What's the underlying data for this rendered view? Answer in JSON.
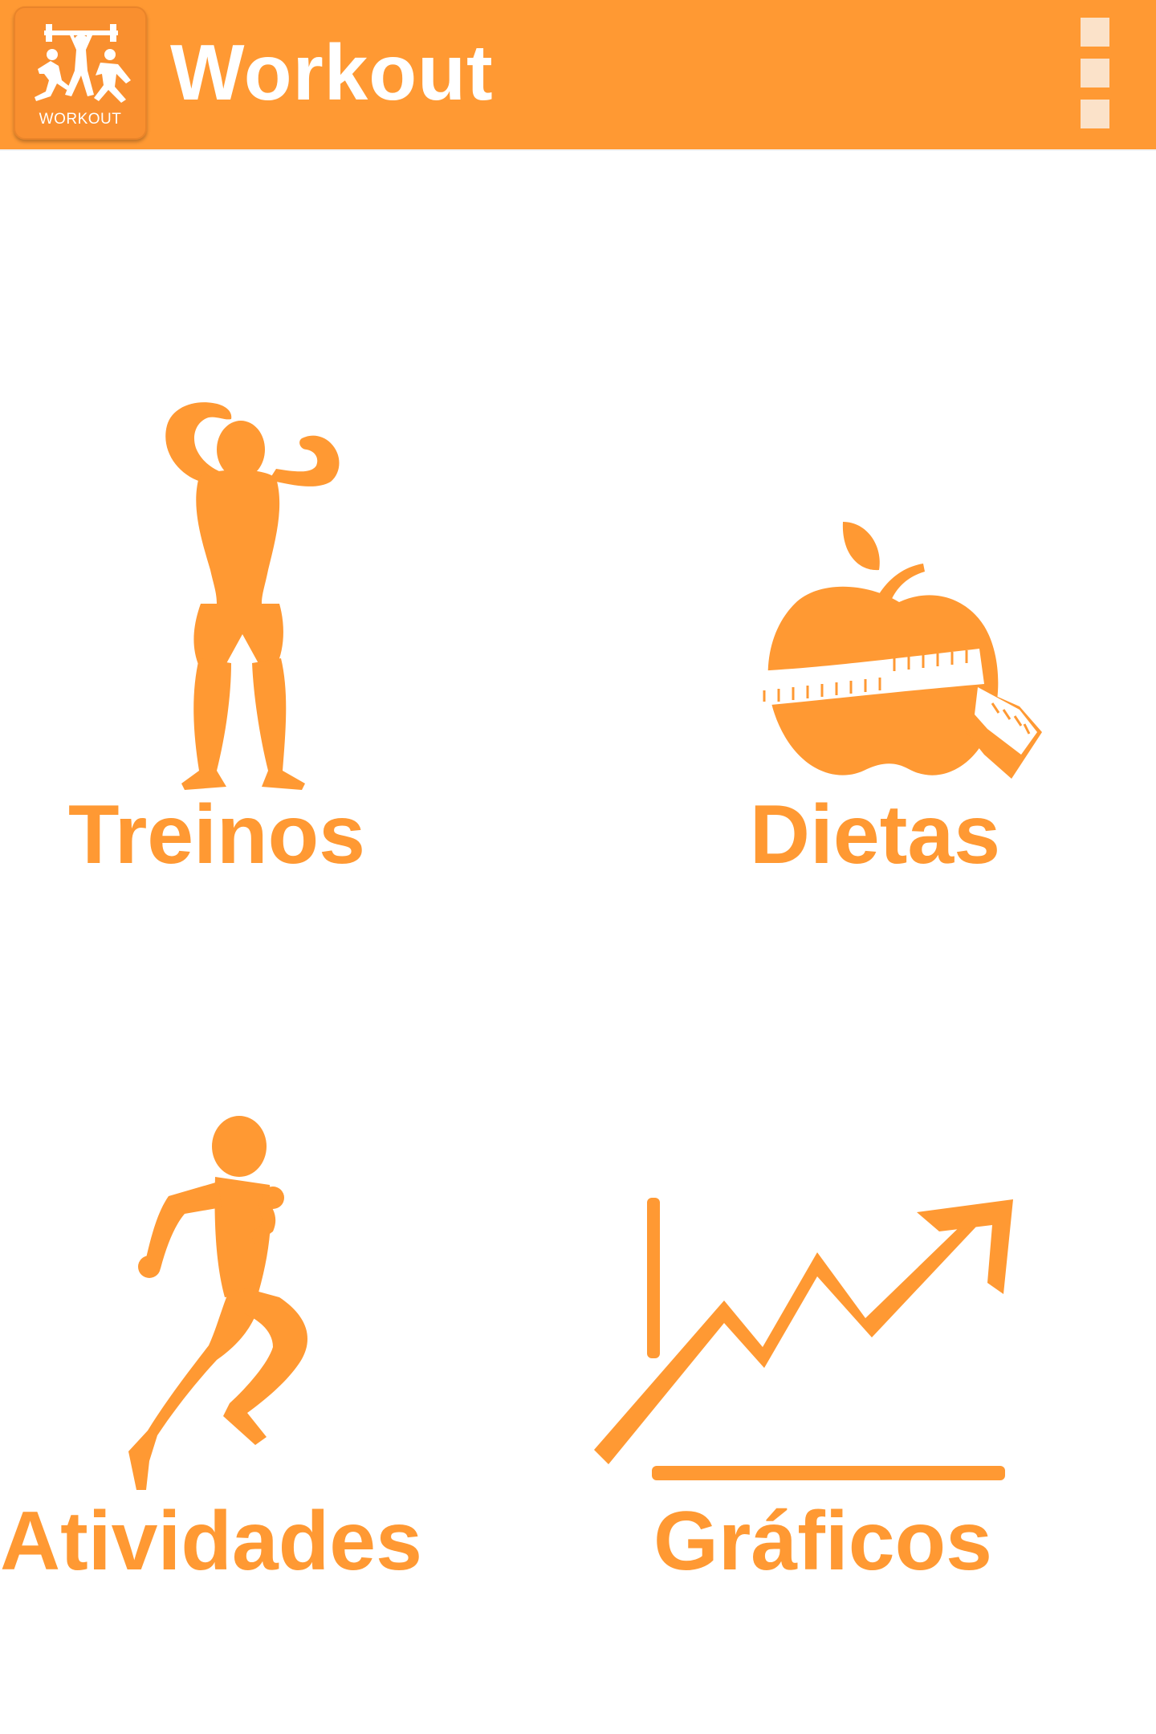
{
  "app": {
    "title": "Workout",
    "logo_text": "WORKOUT",
    "accent_color": "#FF9933",
    "logo_icon": "fitness-people-icon",
    "menu_icon": "overflow-menu-icon"
  },
  "menu": {
    "items": [
      {
        "label": "Treinos",
        "icon": "bodybuilder-icon"
      },
      {
        "label": "Dietas",
        "icon": "apple-measuring-tape-icon"
      },
      {
        "label": "Atividades",
        "icon": "runner-icon"
      },
      {
        "label": "Gráficos",
        "icon": "growth-chart-icon"
      }
    ]
  }
}
